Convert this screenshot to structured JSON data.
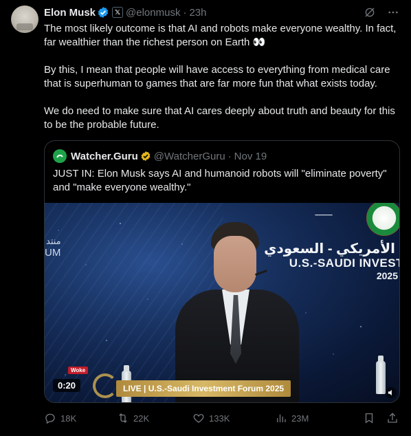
{
  "author": {
    "name": "Elon Musk",
    "handle": "@elonmusk",
    "separator": "·",
    "time": "23h"
  },
  "tweet": {
    "paragraphs": [
      "The most likely outcome is that AI and robots make everyone wealthy. In fact, far wealthier than the richest person on Earth 👀",
      "By this, I mean that people will have access to everything from medical care that is superhuman to games that are far more fun that what exists today.",
      "We do need to make sure that AI cares deeply about truth and beauty for this to be the probable future."
    ]
  },
  "quote": {
    "name": "Watcher.Guru",
    "handle": "@WatcherGuru",
    "separator": "·",
    "date": "Nov 19",
    "text": "JUST IN: Elon Musk says AI and humanoid robots will \"eliminate poverty\" and \"make everyone wealthy.\"",
    "video": {
      "duration": "0:20",
      "live_banner": "LIVE | U.S.-Saudi Investment Forum 2025",
      "sign_left": "UM",
      "sign_left_ar": "منتد",
      "sign_right_ar": "الأمريكي - السعودي",
      "sign_right": "U.S.-SAUDI INVEST",
      "sign_year": "2025",
      "wall_badge": "Woke"
    }
  },
  "actions": {
    "replies": "18K",
    "reposts": "22K",
    "likes": "133K",
    "views": "23M"
  },
  "colors": {
    "background": "#000000",
    "text": "#e7e9ea",
    "muted": "#71767b",
    "verified_blue": "#1d9bf0",
    "verified_gold": "#e2b719",
    "border": "#2f3336"
  }
}
